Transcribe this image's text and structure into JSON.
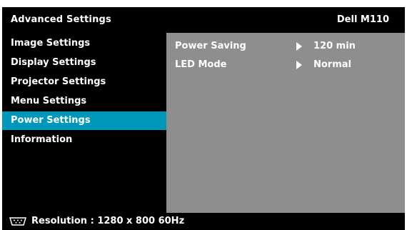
{
  "header": {
    "title": "Advanced Settings",
    "model": "Dell  M110"
  },
  "menu": {
    "items": [
      {
        "label": "Image Settings"
      },
      {
        "label": "Display Settings"
      },
      {
        "label": "Projector Settings"
      },
      {
        "label": "Menu Settings"
      },
      {
        "label": "Power Settings",
        "selected": true
      },
      {
        "label": "Information"
      }
    ]
  },
  "settings": {
    "rows": [
      {
        "label": "Power Saving",
        "value": "120 min"
      },
      {
        "label": "LED Mode",
        "value": "Normal"
      }
    ]
  },
  "footer": {
    "icon": "vga-connector-icon",
    "text": "Resolution : 1280 x 800 60Hz"
  },
  "colors": {
    "selected": "#0097ba",
    "panel": "#8e8e8e",
    "background": "#000000",
    "text": "#ffffff"
  }
}
